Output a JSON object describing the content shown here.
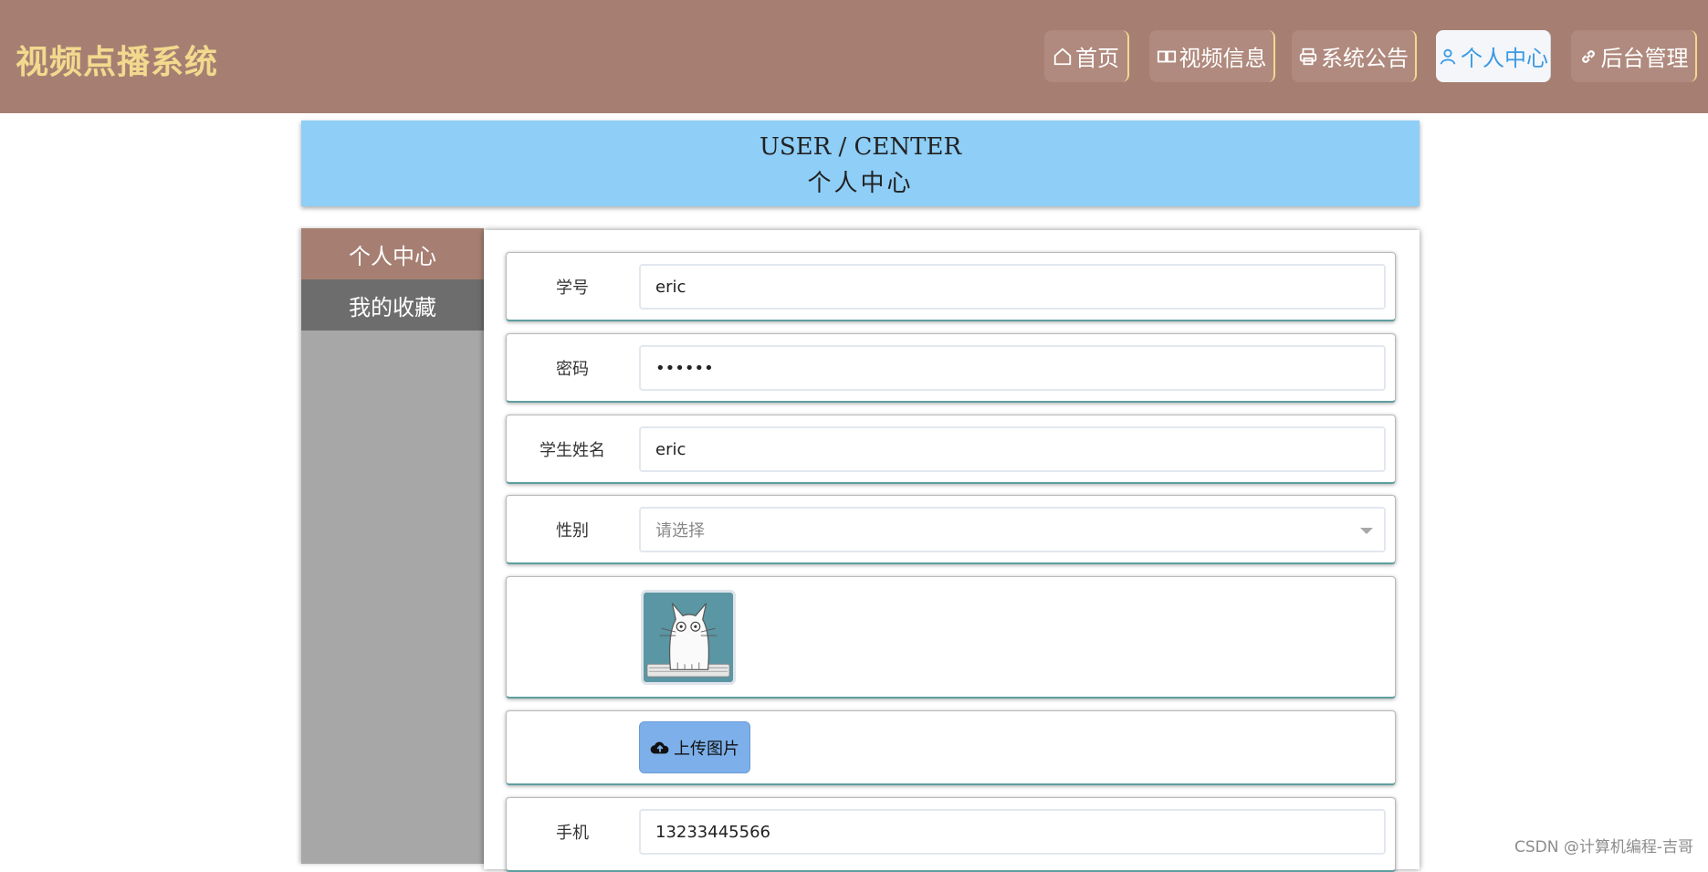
{
  "app": {
    "title": "视频点播系统",
    "brand_color": "#a67f72",
    "accent": "#f2d98e"
  },
  "nav": {
    "home": "首页",
    "videos": "视频信息",
    "notices": "系统公告",
    "profile": "个人中心",
    "admin": "后台管理",
    "active": "profile"
  },
  "banner": {
    "en": "USER / CENTER",
    "zh": "个人中心"
  },
  "sidebar": {
    "items": [
      {
        "label": "个人中心",
        "active": true
      },
      {
        "label": "我的收藏",
        "active": false
      }
    ]
  },
  "form": {
    "student_id": {
      "label": "学号",
      "value": "eric"
    },
    "password": {
      "label": "密码",
      "value": "••••••"
    },
    "student_name": {
      "label": "学生姓名",
      "value": "eric"
    },
    "gender": {
      "label": "性别",
      "placeholder": "请选择"
    },
    "avatar": {
      "alt": "cat-avatar"
    },
    "upload_label": "上传图片",
    "phone": {
      "label": "手机",
      "value": "13233445566"
    }
  },
  "watermark": "CSDN @计算机编程-吉哥"
}
